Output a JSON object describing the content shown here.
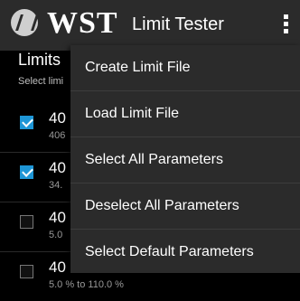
{
  "action_bar": {
    "brand": "WST",
    "title": "Limit Tester"
  },
  "section": {
    "title": "Limits",
    "subtitle": "Select limi"
  },
  "rows": [
    {
      "title": "40",
      "sub": "406",
      "checked": true
    },
    {
      "title": "40",
      "sub": "34.",
      "checked": true
    },
    {
      "title": "40",
      "sub": "5.0",
      "checked": false
    },
    {
      "title": "40",
      "sub": "5.0 % to 110.0 %",
      "checked": false
    }
  ],
  "menu": {
    "items": [
      "Create Limit File",
      "Load Limit File",
      "Select All Parameters",
      "Deselect All Parameters",
      "Select Default Parameters"
    ]
  }
}
